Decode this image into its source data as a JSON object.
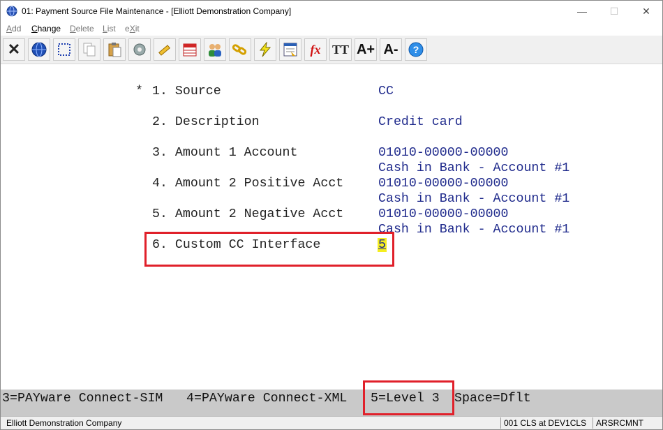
{
  "window": {
    "title": "01: Payment Source File Maintenance - [Elliott Demonstration Company]",
    "controls": {
      "minimize": "—",
      "maximize": "☐",
      "close": "✕"
    }
  },
  "menu": [
    {
      "prefix": "",
      "accel": "A",
      "rest": "dd",
      "enabled": false
    },
    {
      "prefix": "",
      "accel": "C",
      "rest": "hange",
      "enabled": true
    },
    {
      "prefix": "",
      "accel": "D",
      "rest": "elete",
      "enabled": false
    },
    {
      "prefix": "",
      "accel": "L",
      "rest": "ist",
      "enabled": false
    },
    {
      "prefix": "e",
      "accel": "X",
      "rest": "it",
      "enabled": false
    }
  ],
  "toolbar": {
    "icons": [
      "close-icon",
      "globe-icon",
      "select-icon",
      "copy-icon",
      "paste-icon",
      "settings-icon",
      "edit-icon",
      "calendar-icon",
      "users-icon",
      "link-icon",
      "flash-icon",
      "form-icon",
      "function-icon",
      "font-size-icon",
      "font-grow-icon",
      "font-shrink-icon",
      "help-icon"
    ],
    "glyphs": {
      "close": "✕",
      "globe": "●",
      "function": "fx",
      "font_size": "TT",
      "font_grow": "A+",
      "font_shrink": "A-",
      "help": "?"
    }
  },
  "form": {
    "required_marker": "*",
    "fields": [
      {
        "label": "1. Source",
        "value": "CC"
      },
      {
        "label": "2. Description",
        "value": "Credit card"
      },
      {
        "label": "3. Amount 1 Account",
        "value": "01010-00000-00000",
        "desc": "Cash in Bank - Account #1"
      },
      {
        "label": "4. Amount 2 Positive Acct",
        "value": "01010-00000-00000",
        "desc": "Cash in Bank - Account #1"
      },
      {
        "label": "5. Amount 2 Negative Acct",
        "value": "01010-00000-00000",
        "desc": "Cash in Bank - Account #1"
      },
      {
        "label": "6. Custom CC Interface",
        "value": "5"
      }
    ]
  },
  "help_bar": {
    "option3": "3=PAYware Connect-SIM",
    "option4": "4=PAYware Connect-XML",
    "option5": "5=Level 3",
    "space": "Space=Dflt"
  },
  "status_bar": {
    "company": "Elliott Demonstration Company",
    "session": "001 CLS at DEV1CLS",
    "program": "ARSRCMNT"
  }
}
